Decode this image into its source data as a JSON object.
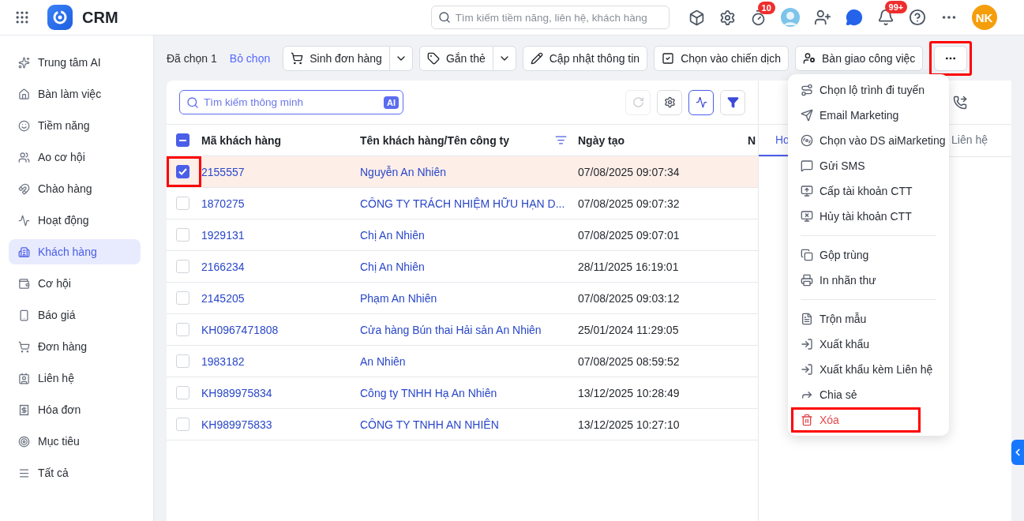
{
  "app": {
    "title": "CRM"
  },
  "search": {
    "placeholder": "Tìm kiếm tiềm năng, liên hệ, khách hàng"
  },
  "header": {
    "timer_badge": "10",
    "notification_badge": "99+",
    "user_initials": "NK"
  },
  "sidebar": {
    "items": [
      {
        "label": "Trung tâm AI",
        "selected": false
      },
      {
        "label": "Bàn làm việc",
        "selected": false
      },
      {
        "label": "Tiềm năng",
        "selected": false
      },
      {
        "label": "Ao cơ hội",
        "selected": false
      },
      {
        "label": "Chào hàng",
        "selected": false
      },
      {
        "label": "Hoạt động",
        "selected": false
      },
      {
        "label": "Khách hàng",
        "selected": true
      },
      {
        "label": "Cơ hội",
        "selected": false
      },
      {
        "label": "Báo giá",
        "selected": false
      },
      {
        "label": "Đơn hàng",
        "selected": false
      },
      {
        "label": "Liên hệ",
        "selected": false
      },
      {
        "label": "Hóa đơn",
        "selected": false
      },
      {
        "label": "Mục tiêu",
        "selected": false
      },
      {
        "label": "Tất cả",
        "selected": false
      }
    ]
  },
  "toolbar": {
    "selected_count": "Đã chọn 1",
    "clear_selection": "Bỏ chọn",
    "actions": [
      {
        "label": "Sinh đơn hàng",
        "split": true
      },
      {
        "label": "Gắn thẻ",
        "split": true
      },
      {
        "label": "Cập nhật thông tin",
        "split": false
      },
      {
        "label": "Chọn vào chiến dịch",
        "split": false
      },
      {
        "label": "Bàn giao công việc",
        "split": false
      }
    ],
    "more_highlighted": true
  },
  "table": {
    "search_placeholder": "Tìm kiếm thông minh",
    "ai_badge": "AI",
    "header_checked": true,
    "header_partial": true,
    "columns": [
      "Mã khách hàng",
      "Tên khách hàng/Tên công ty",
      "Ngày tạo",
      "N"
    ],
    "rows": [
      {
        "code": "2155557",
        "name": "Nguyễn An Nhiên",
        "created": "07/08/2025 09:07:34",
        "checked": true,
        "highlighted": true
      },
      {
        "code": "1870275",
        "name": "CÔNG TY TRÁCH NHIỆM HỮU HẠN D...",
        "created": "07/08/2025 09:07:32",
        "checked": false,
        "highlighted": false
      },
      {
        "code": "1929131",
        "name": "Chị An Nhiên",
        "created": "07/08/2025 09:07:01",
        "checked": false,
        "highlighted": false
      },
      {
        "code": "2166234",
        "name": "Chị An Nhiên",
        "created": "28/11/2025 16:19:01",
        "checked": false,
        "highlighted": false
      },
      {
        "code": "2145205",
        "name": "Phạm An Nhiên",
        "created": "07/08/2025 09:03:12",
        "checked": false,
        "highlighted": false
      },
      {
        "code": "KH0967471808",
        "name": "Cửa hàng Bún thai Hải sản An Nhiên",
        "created": "25/01/2024 11:29:05",
        "checked": false,
        "highlighted": false
      },
      {
        "code": "1983182",
        "name": "An Nhiên",
        "created": "07/08/2025 08:59:52",
        "checked": false,
        "highlighted": false
      },
      {
        "code": "KH989975834",
        "name": "Công ty TNHH Hạ An Nhiên",
        "created": "13/12/2025 10:28:49",
        "checked": false,
        "highlighted": false
      },
      {
        "code": "KH989975833",
        "name": "CÔNG TY TNHH AN NHIÊN",
        "created": "13/12/2025 10:27:10",
        "checked": false,
        "highlighted": false
      }
    ]
  },
  "detail_panel": {
    "tabs": [
      {
        "label": "Ho",
        "selected": true
      },
      {
        "label": "Liên hệ",
        "selected": false
      }
    ]
  },
  "menu": {
    "items": [
      {
        "kind": "item",
        "label": "Chọn lộ trình đi tuyến",
        "danger": false,
        "highlighted": false
      },
      {
        "kind": "item",
        "label": "Email Marketing",
        "danger": false,
        "highlighted": false
      },
      {
        "kind": "item",
        "label": "Chọn vào DS aiMarketing",
        "danger": false,
        "highlighted": false
      },
      {
        "kind": "item",
        "label": "Gửi SMS",
        "danger": false,
        "highlighted": false
      },
      {
        "kind": "item",
        "label": "Cấp tài khoản CTT",
        "danger": false,
        "highlighted": false
      },
      {
        "kind": "item",
        "label": "Hủy tài khoản CTT",
        "danger": false,
        "highlighted": false
      },
      {
        "kind": "divider"
      },
      {
        "kind": "item",
        "label": "Gộp trùng",
        "danger": false,
        "highlighted": false
      },
      {
        "kind": "item",
        "label": "In nhãn thư",
        "danger": false,
        "highlighted": false
      },
      {
        "kind": "divider"
      },
      {
        "kind": "item",
        "label": "Trộn mẫu",
        "danger": false,
        "highlighted": false
      },
      {
        "kind": "item",
        "label": "Xuất khẩu",
        "danger": false,
        "highlighted": false
      },
      {
        "kind": "item",
        "label": "Xuất khẩu kèm Liên hệ",
        "danger": false,
        "highlighted": false
      },
      {
        "kind": "item",
        "label": "Chia sẻ",
        "danger": false,
        "highlighted": false
      },
      {
        "kind": "item",
        "label": "Xóa",
        "danger": true,
        "highlighted": true
      }
    ]
  }
}
